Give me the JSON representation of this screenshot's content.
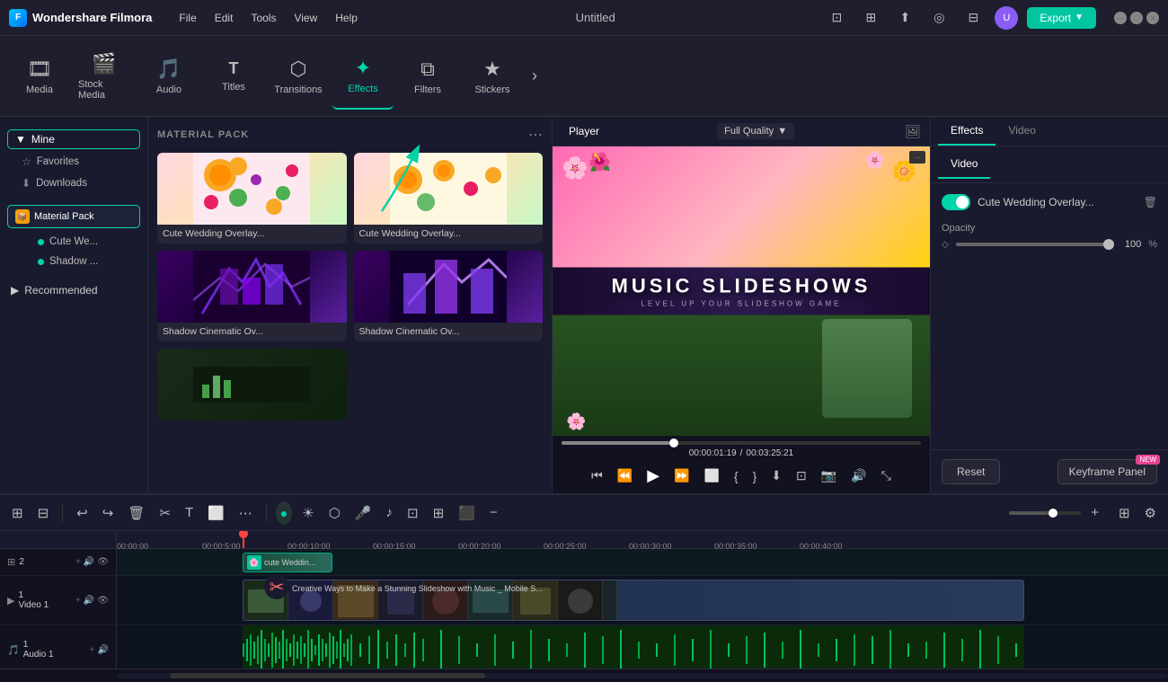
{
  "app": {
    "name": "Wondershare Filmora",
    "title": "Untitled"
  },
  "menu": {
    "items": [
      "File",
      "Edit",
      "Tools",
      "View",
      "Help"
    ]
  },
  "toolbar": {
    "tools": [
      {
        "id": "media",
        "label": "Media",
        "icon": "🎞"
      },
      {
        "id": "stock",
        "label": "Stock Media",
        "icon": "🎬"
      },
      {
        "id": "audio",
        "label": "Audio",
        "icon": "🎵"
      },
      {
        "id": "titles",
        "label": "Titles",
        "icon": "T"
      },
      {
        "id": "transitions",
        "label": "Transitions",
        "icon": "⬡"
      },
      {
        "id": "effects",
        "label": "Effects",
        "icon": "✦"
      },
      {
        "id": "filters",
        "label": "Filters",
        "icon": "◫"
      },
      {
        "id": "stickers",
        "label": "Stickers",
        "icon": "★"
      }
    ],
    "active": "effects",
    "export_label": "Export"
  },
  "sidebar": {
    "mine_label": "Mine",
    "favorites_label": "Favorites",
    "downloads_label": "Downloads",
    "material_pack_label": "Material Pack",
    "recommended_label": "Recommended",
    "items": [
      {
        "label": "Cute We...",
        "dot": true
      },
      {
        "label": "Shadow ...",
        "dot": true
      }
    ]
  },
  "effects_panel": {
    "section_label": "MATERIAL PACK",
    "cards": [
      {
        "label": "Cute Wedding Overlay...",
        "type": "cute"
      },
      {
        "label": "Cute Wedding Overlay...",
        "type": "cute2"
      },
      {
        "label": "Shadow Cinematic Ov...",
        "type": "shadow"
      },
      {
        "label": "Shadow Cinematic Ov...",
        "type": "shadow2"
      },
      {
        "label": "",
        "type": "green"
      }
    ]
  },
  "player": {
    "tab": "Player",
    "quality": "Full Quality",
    "video_text": "MUSIC SLIDESHOWS",
    "video_subtext": "LEVEL UP YOUR SLIDESHOW GAME",
    "time_current": "00:00:01:19",
    "time_total": "00:03:25:21"
  },
  "right_panel": {
    "tabs": [
      "Effects",
      "Video"
    ],
    "active_tab": "Effects",
    "active_sub_tab": "Video",
    "effect_name": "Cute Wedding Overlay...",
    "opacity_label": "Opacity",
    "opacity_value": "100",
    "opacity_percent": "%",
    "reset_label": "Reset",
    "keyframe_label": "Keyframe Panel",
    "new_badge": "NEW"
  },
  "timeline": {
    "tracks": [
      {
        "type": "overlay",
        "label": "2",
        "clip_text": "cute Weddin..."
      },
      {
        "type": "video",
        "label": "Video 1"
      },
      {
        "type": "audio",
        "label": "Audio 1"
      }
    ],
    "time_marks": [
      "00:00:00",
      "00:00:5:00",
      "00:00:10:00",
      "00:00:15:00",
      "00:00:20:00",
      "00:00:25:00",
      "00:00:30:00",
      "00:00:35:00",
      "00:00:40:00"
    ],
    "video_clip_label": "Creative Ways to Make a Stunning Slideshow with Music _ Mobile S..."
  }
}
